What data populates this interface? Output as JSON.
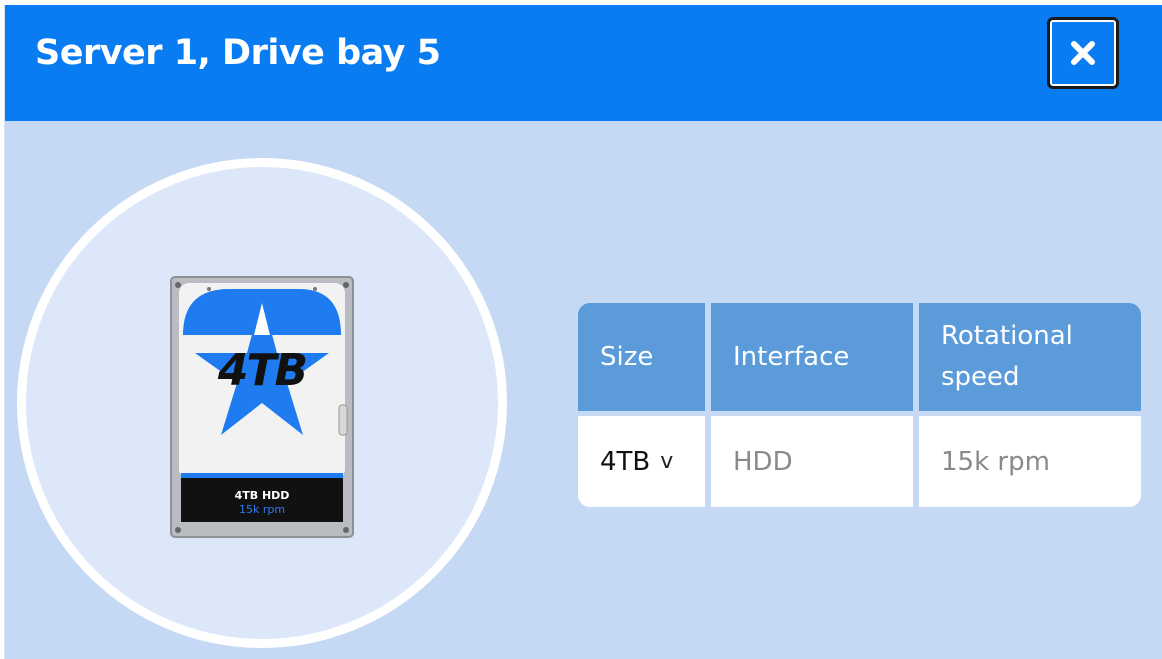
{
  "dialog": {
    "title": "Server 1, Drive bay 5",
    "close_icon": "close-icon"
  },
  "drive_image": {
    "size_text": "4TB",
    "label_line_1": "4TB HDD",
    "label_line_2": "15k rpm"
  },
  "spec_table": {
    "headers": [
      "Size",
      "Interface",
      "Rotational speed"
    ],
    "header_lines": {
      "rotational_1": "Rotational",
      "rotational_2": "speed"
    },
    "row": {
      "size": "4TB",
      "size_chevron": "v",
      "interface": "HDD",
      "speed": "15k rpm"
    }
  },
  "colors": {
    "titlebar": "#0a7cf2",
    "body": "#c5d9f5",
    "table_header": "#5b9bd9",
    "star": "#1f7cf0"
  }
}
